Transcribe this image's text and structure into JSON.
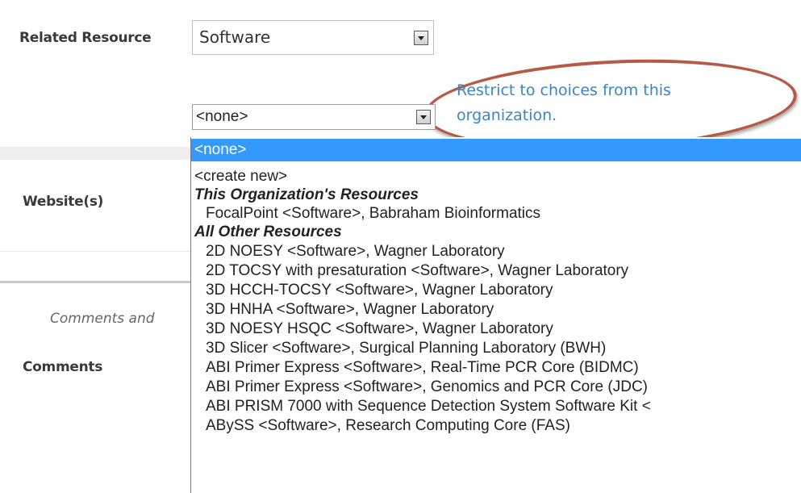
{
  "form": {
    "related_resource_label": "Related Resource",
    "website_label": "Website(s)",
    "comments_section_label": "Comments and",
    "comments_label": "Comments",
    "type_select_value": "Software",
    "resource_select_value": "<none>",
    "hint_line1": "Restrict to choices from this",
    "hint_line2": "organization."
  },
  "dropdown": {
    "none": "<none>",
    "create_new": "<create new>",
    "group1_label": "This Organization's Resources",
    "group1_items": [
      "FocalPoint <Software>, Babraham Bioinformatics"
    ],
    "group2_label": "All Other Resources",
    "group2_items": [
      "2D NOESY <Software>, Wagner Laboratory",
      "2D TOCSY with presaturation <Software>, Wagner Laboratory",
      "3D HCCH-TOCSY <Software>, Wagner Laboratory",
      "3D HNHA <Software>, Wagner Laboratory",
      "3D NOESY HSQC <Software>, Wagner Laboratory",
      "3D Slicer <Software>, Surgical Planning Laboratory (BWH)",
      "ABI Primer Express <Software>, Real-Time PCR Core (BIDMC)",
      "ABI Primer Express <Software>, Genomics and PCR Core (JDC)",
      "ABI PRISM 7000 with Sequence Detection System Software Kit <",
      "ABySS <Software>, Research Computing Core (FAS)"
    ]
  },
  "colors": {
    "selected_bg": "#3399ff",
    "hint_text": "#3a86c4",
    "annotation_oval": "#b55a45"
  }
}
